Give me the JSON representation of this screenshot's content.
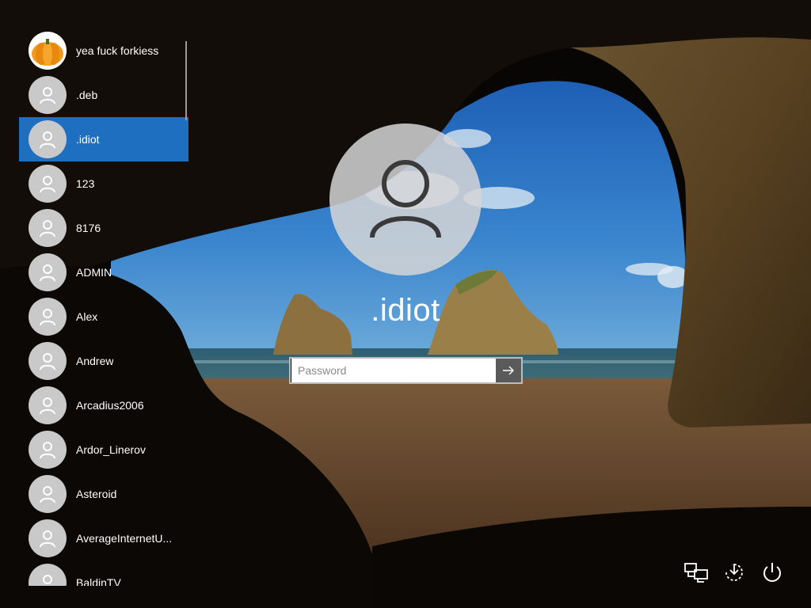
{
  "login": {
    "selected_user": ".idiot",
    "password_placeholder": "Password"
  },
  "users": [
    {
      "name": "yea fuck forkiess",
      "avatar": "pumpkin"
    },
    {
      "name": ".deb",
      "avatar": "default"
    },
    {
      "name": ".idiot",
      "avatar": "default",
      "selected": true
    },
    {
      "name": "123",
      "avatar": "default"
    },
    {
      "name": "8176",
      "avatar": "default"
    },
    {
      "name": "ADMIN",
      "avatar": "default"
    },
    {
      "name": "Alex",
      "avatar": "default"
    },
    {
      "name": "Andrew",
      "avatar": "default"
    },
    {
      "name": "Arcadius2006",
      "avatar": "default"
    },
    {
      "name": "Ardor_Linerov",
      "avatar": "default"
    },
    {
      "name": "Asteroid",
      "avatar": "default"
    },
    {
      "name": "AverageInternetU...",
      "avatar": "default"
    },
    {
      "name": "BaldinTV",
      "avatar": "default"
    }
  ],
  "icons": {
    "network": "network-icon",
    "accessibility": "ease-of-access-icon",
    "power": "power-icon",
    "submit": "arrow-right-icon"
  },
  "colors": {
    "selection": "#1e6fbf",
    "avatar_bg": "#c9c9c9"
  }
}
